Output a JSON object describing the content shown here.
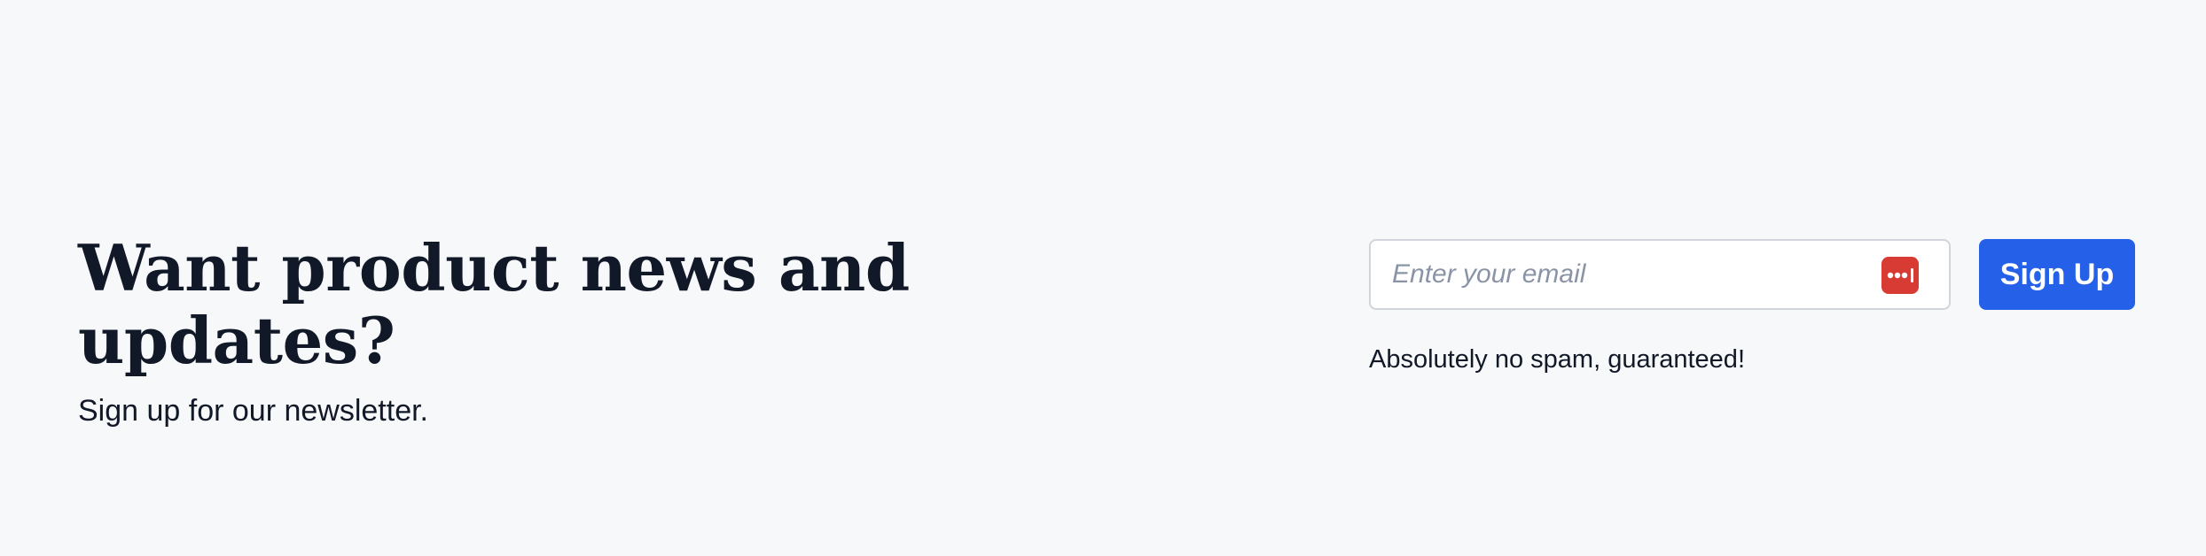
{
  "newsletter": {
    "headline": "Want product news and updates?",
    "subheadline": "Sign up for our newsletter.",
    "email_placeholder": "Enter your email",
    "email_value": "",
    "password_manager_icon": "password-manager-icon",
    "submit_label": "Sign Up",
    "disclaimer": "Absolutely no spam, guaranteed!"
  },
  "colors": {
    "background": "#f7f8fa",
    "text": "#111827",
    "button": "#2460e8",
    "password_manager_icon": "#d83a34",
    "input_border": "#d1d5db"
  }
}
